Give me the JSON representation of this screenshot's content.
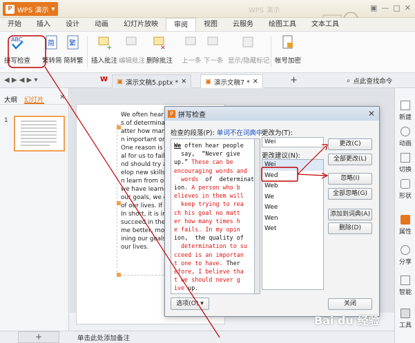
{
  "app": {
    "name": "WPS 演示",
    "ghost_title": "WPS 演示"
  },
  "menubar": [
    "开始",
    "插入",
    "设计",
    "动画",
    "幻灯片放映",
    "审阅",
    "视图",
    "云服务",
    "绘图工具",
    "文本工具"
  ],
  "active_menu": "审阅",
  "ribbon": {
    "spell": "拼写检查",
    "trad2simp": "繁转简",
    "simp2trad": "简转繁",
    "insert_comment": "插入批注",
    "edit_comment": "编辑批注",
    "delete_comment": "删除批注",
    "prev": "上一条",
    "next": "下一条",
    "show_hide": "显示/隐藏标记",
    "encrypt": "帐号加密"
  },
  "tabs": {
    "doc1": "演示文稿5.pptx *",
    "doc2": "演示文稿7 *",
    "search": "点此查找命令"
  },
  "leftpanel": {
    "tab_outline": "大纲",
    "tab_slides": "幻灯片",
    "slide_num": "1"
  },
  "slide_lines": [
    "We often hear peo",
    "s of determinatio",
    "atter how many ti",
    "n important one",
    " One reason is th",
    "al for us to fail in",
    "nd should try aga",
    "elop new skills an",
    "n learn from our",
    "we have learned",
    "our goals, we de",
    "of our lives. If we",
    " In short, it is imp",
    "succeed in the en",
    "me better, more",
    "ining our goals. b",
    "our lives."
  ],
  "rightbar": [
    "新建",
    "动画",
    "切换",
    "形状",
    "属性",
    "分享",
    "智能",
    "工具"
  ],
  "statusbar": {
    "add": "+",
    "notes": "单击此处添加备注"
  },
  "dialog": {
    "title": "拼写检查",
    "sentence_label": "检查的段落(P):",
    "not_in_dict": "单词不在词典中",
    "change_to_label": "更改为(T):",
    "change_to_value": "Wei",
    "suggest_label": "更改建议(N):",
    "suggestions": [
      "Wei",
      "Wed",
      "Web",
      "We",
      "Wee",
      "Wen",
      "Wet"
    ],
    "selected_index": 0,
    "btn_change": "更改(C)",
    "btn_change_all": "全部更改(L)",
    "btn_ignore": "忽略(I)",
    "btn_ignore_all": "全部忽略(G)",
    "btn_add": "添加到词典(A)",
    "btn_delete": "删除(D)",
    "btn_options": "选项(O)",
    "btn_close": "关闭"
  },
  "sentence_text": {
    "l1a": "We",
    "l1b": " often hear people",
    "l2": "  say,  “Never give",
    "l3a": "up.”",
    "l3b": " These can be",
    "l4": "encouraging words and",
    "l5a": "  words",
    "l5b": "  of  determinat",
    "l6a": "ion.",
    "l6b": " A person who b",
    "l7": "elieves in them will",
    "l8": "  keep trying to rea",
    "l9": "ch his goal no matt",
    "l10": "er how many times h",
    "l11": "e fails. In my opin",
    "l12": "ion,  the quality of",
    "l13": "  determination to su",
    "l14": "cceed is an importan",
    "l15a": "t one to have. ",
    "l15b": "Ther",
    "l16": "efore, I believe tha",
    "l17": "t we should never g",
    "l18a": "ive ",
    "l18b": "up."
  },
  "watermark": "Bai du 经验",
  "colors": {
    "accent": "#e5771e",
    "annotation": "#c00000",
    "link_blue": "#1a4fc4"
  }
}
